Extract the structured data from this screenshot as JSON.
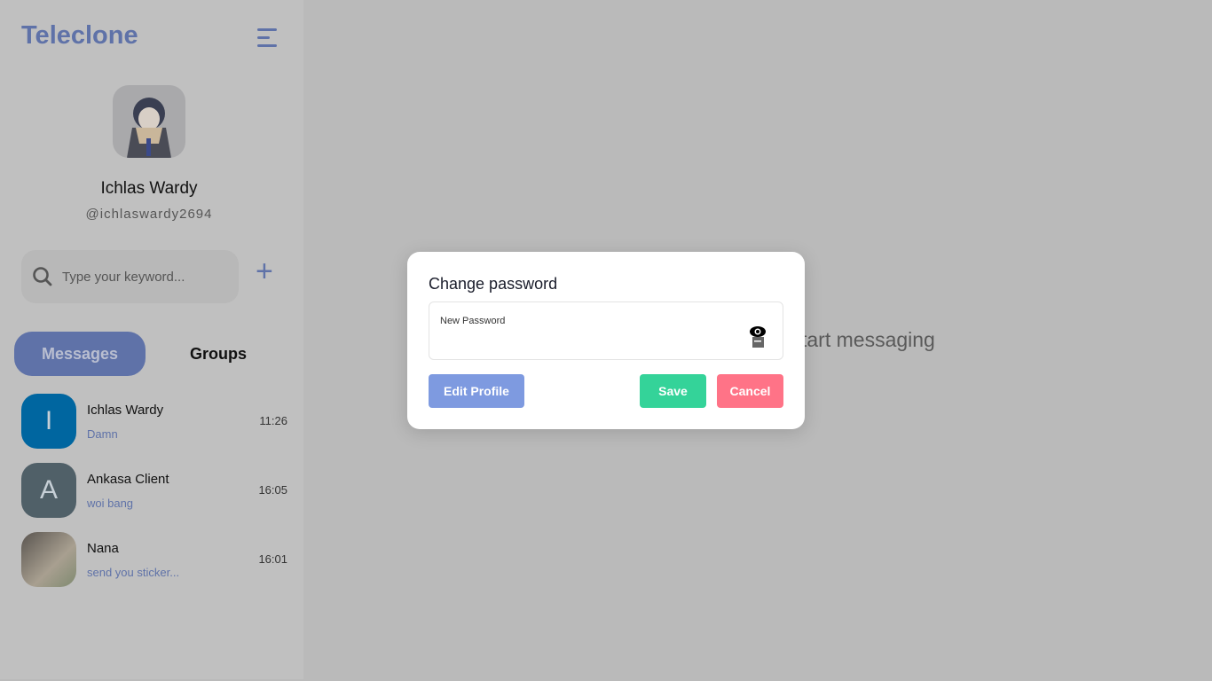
{
  "app": {
    "title": "Teleclone"
  },
  "profile": {
    "name": "Ichlas Wardy",
    "handle": "@ichlaswardy2694"
  },
  "search": {
    "placeholder": "Type your keyword..."
  },
  "tabs": [
    {
      "label": "Messages",
      "active": true
    },
    {
      "label": "Groups",
      "active": false
    }
  ],
  "chats": [
    {
      "initial": "I",
      "name": "Ichlas Wardy",
      "message": "Damn",
      "time": "11:26",
      "color": "#0066a0"
    },
    {
      "initial": "A",
      "name": "Ankasa Client",
      "message": "woi bang",
      "time": "16:05",
      "color": "#506068"
    },
    {
      "initial": "",
      "name": "Nana",
      "message": "send you sticker...",
      "time": "16:01",
      "color": "#8a8478"
    }
  ],
  "main": {
    "empty_text": "tart messaging"
  },
  "modal": {
    "title": "Change password",
    "field_label": "New Password",
    "field_value": "",
    "edit_label": "Edit Profile",
    "save_label": "Save",
    "cancel_label": "Cancel"
  },
  "colors": {
    "accent": "#7e9ae0",
    "save": "#34d399",
    "cancel": "#ff7387"
  }
}
